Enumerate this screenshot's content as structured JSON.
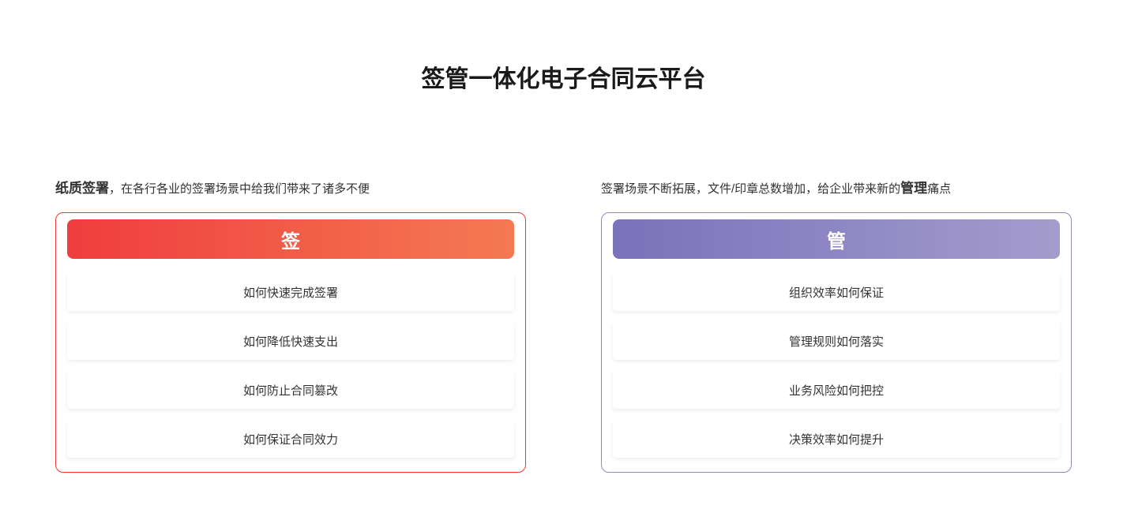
{
  "title": "签管一体化电子合同云平台",
  "left": {
    "intro_bold": "纸质签署",
    "intro_rest": "，在各行各业的签署场景中给我们带来了诸多不便",
    "header": "签",
    "items": [
      "如何快速完成签署",
      "如何降低快速支出",
      "如何防止合同篡改",
      "如何保证合同效力"
    ]
  },
  "right": {
    "intro_pre": "签署场景不断拓展，文件/印章总数增加，给企业带来新的",
    "intro_bold": "管理",
    "intro_post": "痛点",
    "header": "管",
    "items": [
      "组织效率如何保证",
      "管理规则如何落实",
      "业务风险如何把控",
      "决策效率如何提升"
    ]
  }
}
